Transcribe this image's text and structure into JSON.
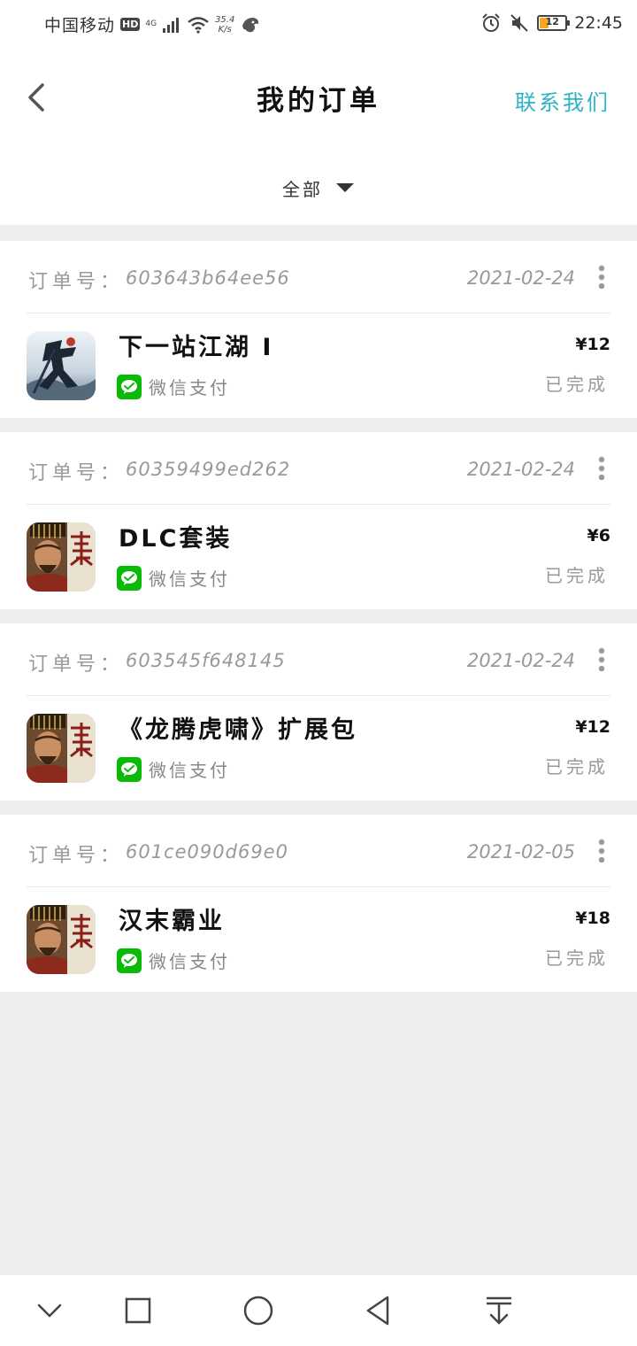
{
  "status_bar": {
    "carrier": "中国移动",
    "hd": "HD",
    "network": "4G",
    "speed_value": "35.4",
    "speed_unit": "K/s",
    "battery_level": "12",
    "time": "22:45"
  },
  "header": {
    "title": "我的订单",
    "contact": "联系我们"
  },
  "filter": {
    "selected": "全部"
  },
  "order_label": "订单号：",
  "pay_method": "微信支付",
  "orders": [
    {
      "id": "603643b64ee56",
      "date": "2021-02-24",
      "product": "下一站江湖 I",
      "price": "¥12",
      "status": "已完成",
      "icon": "xia-game-icon"
    },
    {
      "id": "60359499ed262",
      "date": "2021-02-24",
      "product": "DLC套装",
      "price": "¥6",
      "status": "已完成",
      "icon": "han-game-icon"
    },
    {
      "id": "603545f648145",
      "date": "2021-02-24",
      "product": "《龙腾虎啸》扩展包",
      "price": "¥12",
      "status": "已完成",
      "icon": "han-game-icon"
    },
    {
      "id": "601ce090d69e0",
      "date": "2021-02-05",
      "product": "汉末霸业",
      "price": "¥18",
      "status": "已完成",
      "icon": "han-game-icon"
    }
  ],
  "colors": {
    "accent": "#2bb4c6",
    "wechat_green": "#09bb07",
    "battery_low": "#f5a623",
    "background": "#eeeeee"
  },
  "nav_icons": [
    "chevron-down-icon",
    "recent-apps-icon",
    "home-icon",
    "back-icon",
    "notification-pull-icon"
  ]
}
